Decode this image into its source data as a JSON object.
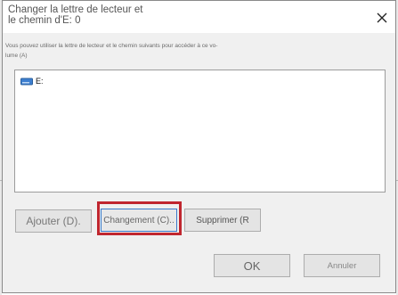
{
  "dialog": {
    "title_line1": "Changer la lettre de lecteur et",
    "title_line2": "le chemin d'E: 0",
    "description_line1": "Vous pouvez utiliser la lettre de lecteur et le chemin suivants pour accéder à ce vo-",
    "description_line2": "lume (A)",
    "list_items": [
      {
        "label": "E:",
        "icon": "drive-icon"
      }
    ],
    "buttons": {
      "add": "Ajouter (D).",
      "change": "Changement (C)..",
      "delete": "Supprimer (R",
      "ok": "OK",
      "cancel": "Annuler"
    }
  },
  "icons": {
    "close": "close-icon",
    "drive": "drive-icon"
  },
  "colors": {
    "highlight": "#c0262f",
    "focus_border": "#3a78c8"
  }
}
